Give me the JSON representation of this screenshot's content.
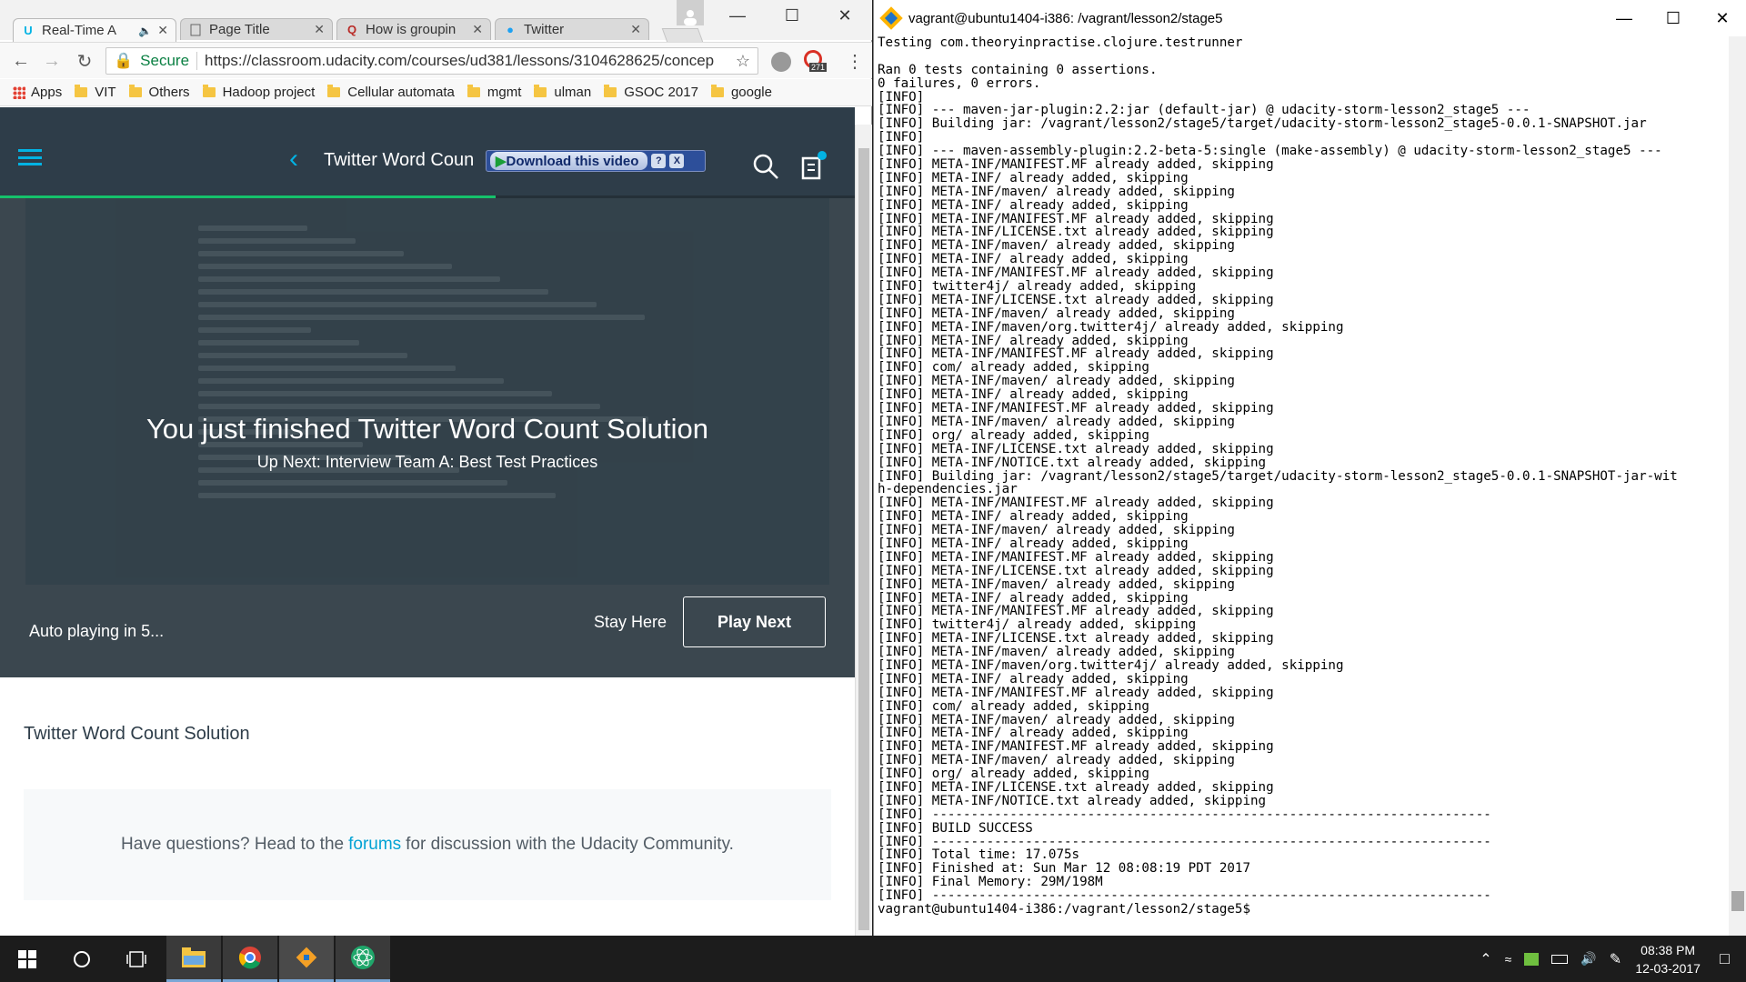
{
  "chrome": {
    "tabs": [
      {
        "label": "Real-Time A",
        "icon": "udacity-icon",
        "active": true,
        "audio": true
      },
      {
        "label": "Page Title",
        "icon": "page-icon"
      },
      {
        "label": "How is groupin",
        "icon": "quora-icon"
      },
      {
        "label": "Twitter",
        "icon": "twitter-icon"
      }
    ],
    "secure_label": "Secure",
    "url": "https://classroom.udacity.com/courses/ud381/lessons/3104628625/concep",
    "extension_badge": "271",
    "bookmarks": [
      "Apps",
      "VIT",
      "Others",
      "Hadoop project",
      "Cellular automata",
      "mgmt",
      "ulman",
      "GSOC 2017",
      "google"
    ],
    "page": {
      "header_title": "Twitter Word Coun",
      "download_label": "Download this video",
      "video": {
        "title": "You just finished Twitter Word Count Solution",
        "up_next": "Up Next: Interview Team A: Best Test Practices",
        "autoplay": "Auto playing in  5...",
        "stay_here": "Stay Here",
        "play_next": "Play Next",
        "progress_percent": 58
      },
      "content_title": "Twitter Word Count Solution",
      "forum": {
        "before": "Have questions? Head to the",
        "link": "forums",
        "after": "for discussion with the Udacity Community."
      }
    }
  },
  "terminal": {
    "title": "vagrant@ubuntu1404-i386: /vagrant/lesson2/stage5",
    "lines": [
      "Testing com.theoryinpractise.clojure.testrunner",
      "",
      "Ran 0 tests containing 0 assertions.",
      "0 failures, 0 errors.",
      "[INFO]",
      "[INFO] --- maven-jar-plugin:2.2:jar (default-jar) @ udacity-storm-lesson2_stage5 ---",
      "[INFO] Building jar: /vagrant/lesson2/stage5/target/udacity-storm-lesson2_stage5-0.0.1-SNAPSHOT.jar",
      "[INFO]",
      "[INFO] --- maven-assembly-plugin:2.2-beta-5:single (make-assembly) @ udacity-storm-lesson2_stage5 ---",
      "[INFO] META-INF/MANIFEST.MF already added, skipping",
      "[INFO] META-INF/ already added, skipping",
      "[INFO] META-INF/maven/ already added, skipping",
      "[INFO] META-INF/ already added, skipping",
      "[INFO] META-INF/MANIFEST.MF already added, skipping",
      "[INFO] META-INF/LICENSE.txt already added, skipping",
      "[INFO] META-INF/maven/ already added, skipping",
      "[INFO] META-INF/ already added, skipping",
      "[INFO] META-INF/MANIFEST.MF already added, skipping",
      "[INFO] twitter4j/ already added, skipping",
      "[INFO] META-INF/LICENSE.txt already added, skipping",
      "[INFO] META-INF/maven/ already added, skipping",
      "[INFO] META-INF/maven/org.twitter4j/ already added, skipping",
      "[INFO] META-INF/ already added, skipping",
      "[INFO] META-INF/MANIFEST.MF already added, skipping",
      "[INFO] com/ already added, skipping",
      "[INFO] META-INF/maven/ already added, skipping",
      "[INFO] META-INF/ already added, skipping",
      "[INFO] META-INF/MANIFEST.MF already added, skipping",
      "[INFO] META-INF/maven/ already added, skipping",
      "[INFO] org/ already added, skipping",
      "[INFO] META-INF/LICENSE.txt already added, skipping",
      "[INFO] META-INF/NOTICE.txt already added, skipping",
      "[INFO] Building jar: /vagrant/lesson2/stage5/target/udacity-storm-lesson2_stage5-0.0.1-SNAPSHOT-jar-wit",
      "h-dependencies.jar",
      "[INFO] META-INF/MANIFEST.MF already added, skipping",
      "[INFO] META-INF/ already added, skipping",
      "[INFO] META-INF/maven/ already added, skipping",
      "[INFO] META-INF/ already added, skipping",
      "[INFO] META-INF/MANIFEST.MF already added, skipping",
      "[INFO] META-INF/LICENSE.txt already added, skipping",
      "[INFO] META-INF/maven/ already added, skipping",
      "[INFO] META-INF/ already added, skipping",
      "[INFO] META-INF/MANIFEST.MF already added, skipping",
      "[INFO] twitter4j/ already added, skipping",
      "[INFO] META-INF/LICENSE.txt already added, skipping",
      "[INFO] META-INF/maven/ already added, skipping",
      "[INFO] META-INF/maven/org.twitter4j/ already added, skipping",
      "[INFO] META-INF/ already added, skipping",
      "[INFO] META-INF/MANIFEST.MF already added, skipping",
      "[INFO] com/ already added, skipping",
      "[INFO] META-INF/maven/ already added, skipping",
      "[INFO] META-INF/ already added, skipping",
      "[INFO] META-INF/MANIFEST.MF already added, skipping",
      "[INFO] META-INF/maven/ already added, skipping",
      "[INFO] org/ already added, skipping",
      "[INFO] META-INF/LICENSE.txt already added, skipping",
      "[INFO] META-INF/NOTICE.txt already added, skipping",
      "[INFO] ------------------------------------------------------------------------",
      "[INFO] BUILD SUCCESS",
      "[INFO] ------------------------------------------------------------------------",
      "[INFO] Total time: 17.075s",
      "[INFO] Finished at: Sun Mar 12 08:08:19 PDT 2017",
      "[INFO] Final Memory: 29M/198M",
      "[INFO] ------------------------------------------------------------------------",
      "vagrant@ubuntu1404-i386:/vagrant/lesson2/stage5$"
    ]
  },
  "taskbar": {
    "time": "08:38 PM",
    "date": "12-03-2017"
  },
  "colors": {
    "udacity_dark": "#2e3d49",
    "udacity_accent": "#02b3e4",
    "progress": "#15c26b"
  }
}
